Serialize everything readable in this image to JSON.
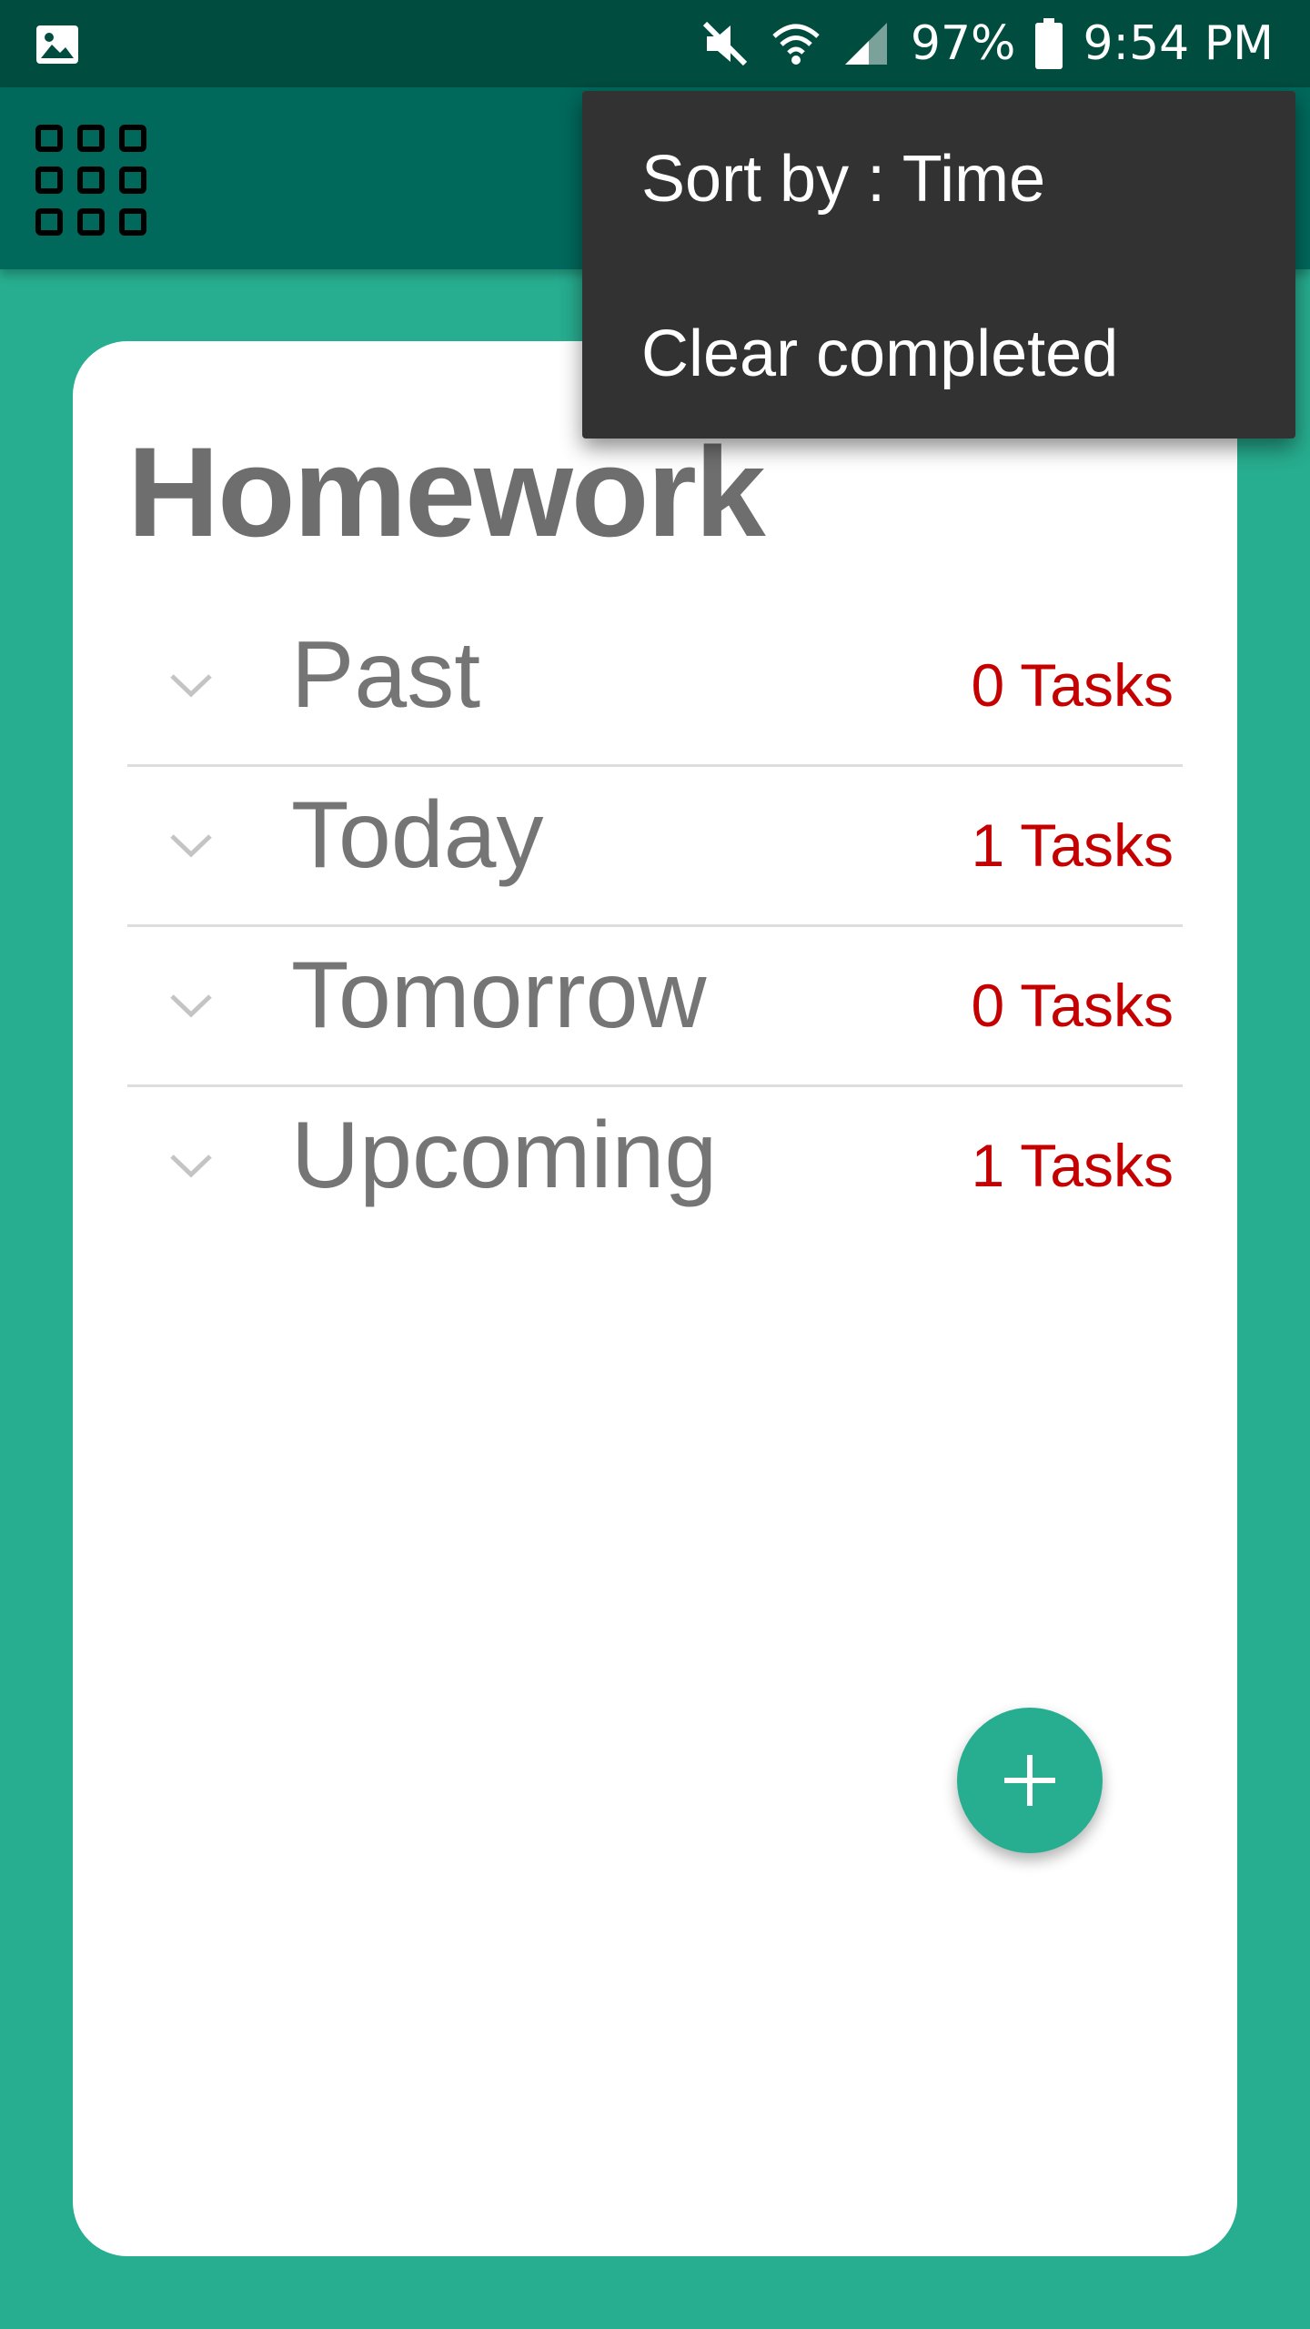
{
  "status_bar": {
    "battery": "97%",
    "time": "9:54 PM",
    "icons": [
      "image-icon",
      "mute-icon",
      "wifi-icon",
      "signal-icon",
      "battery-icon"
    ]
  },
  "app_bar": {
    "menu_icon": "grid-menu-icon"
  },
  "overflow_menu": {
    "items": [
      {
        "label": "Sort by : Time"
      },
      {
        "label": "Clear completed"
      }
    ]
  },
  "card": {
    "title": "Homework",
    "groups": [
      {
        "label": "Past",
        "count": "0 Tasks"
      },
      {
        "label": "Today",
        "count": "1 Tasks"
      },
      {
        "label": "Tomorrow",
        "count": "0 Tasks"
      },
      {
        "label": "Upcoming",
        "count": "1 Tasks"
      }
    ]
  },
  "fab": {
    "icon": "plus-icon"
  },
  "colors": {
    "status_bar": "#004d40",
    "app_bar": "#00695c",
    "background": "#27ad8f",
    "menu": "#323232",
    "task_count": "#c50000",
    "text_gray": "#757575"
  }
}
